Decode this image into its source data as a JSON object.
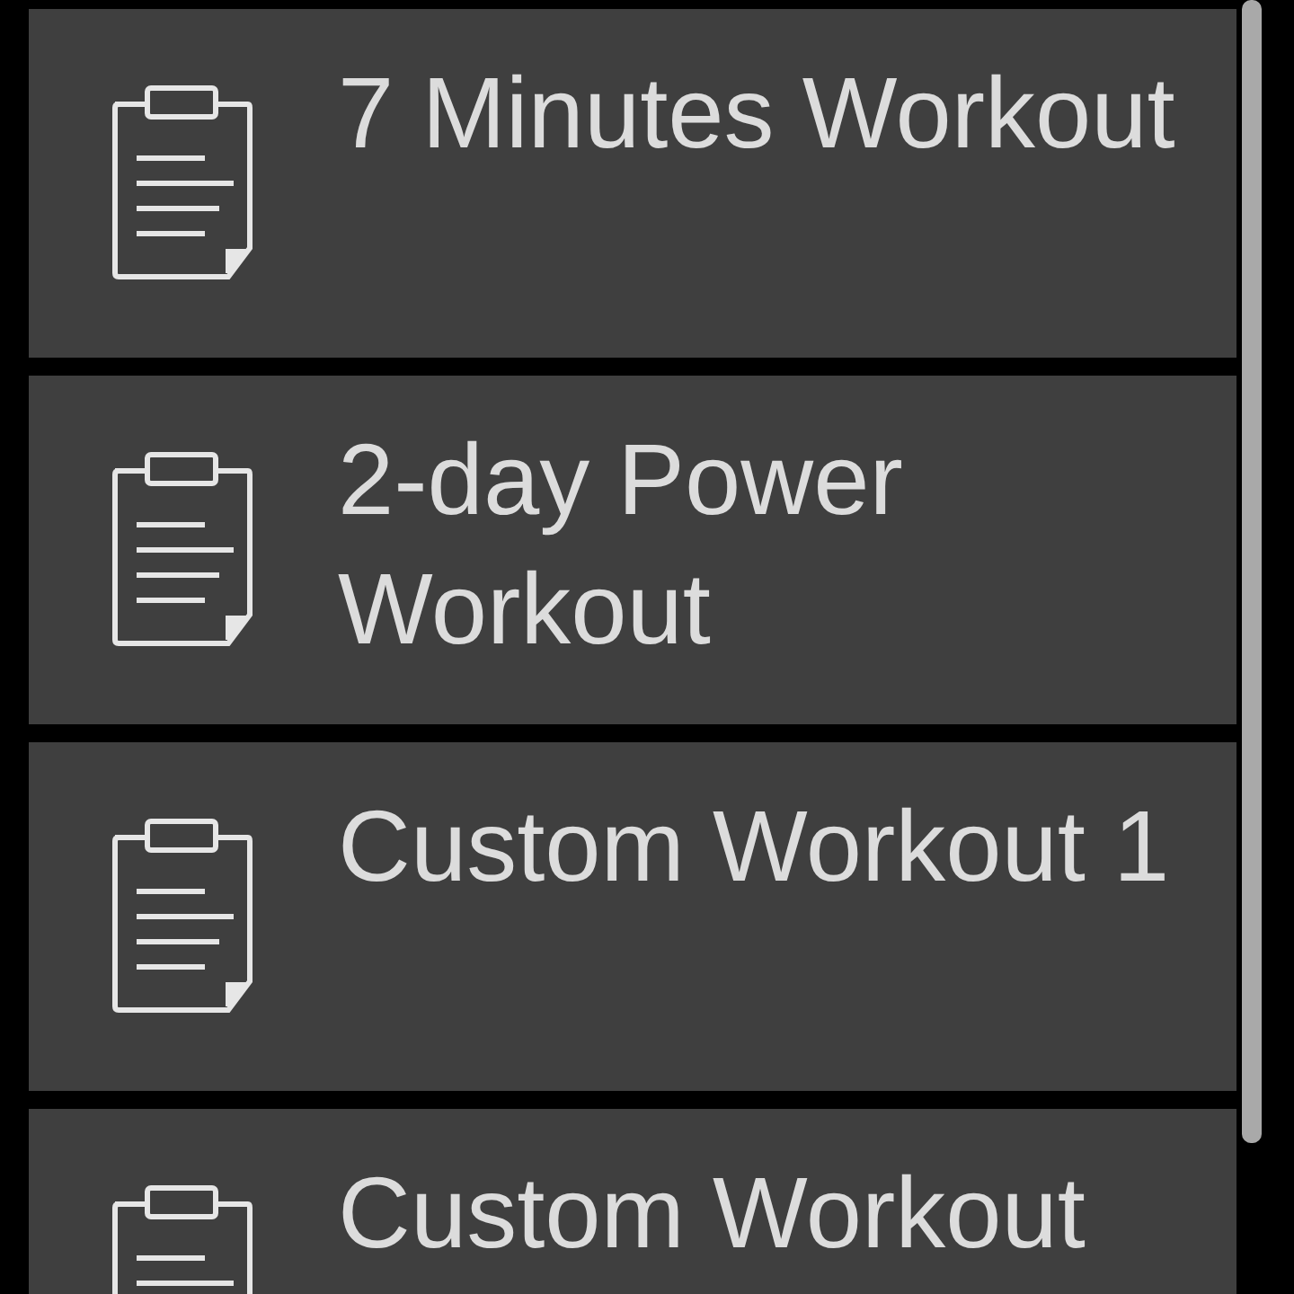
{
  "workouts": [
    {
      "name": "7 Minutes Workout"
    },
    {
      "name": "2-day Power Workout"
    },
    {
      "name": "Custom Workout 1"
    },
    {
      "name": "Custom Workout"
    }
  ]
}
